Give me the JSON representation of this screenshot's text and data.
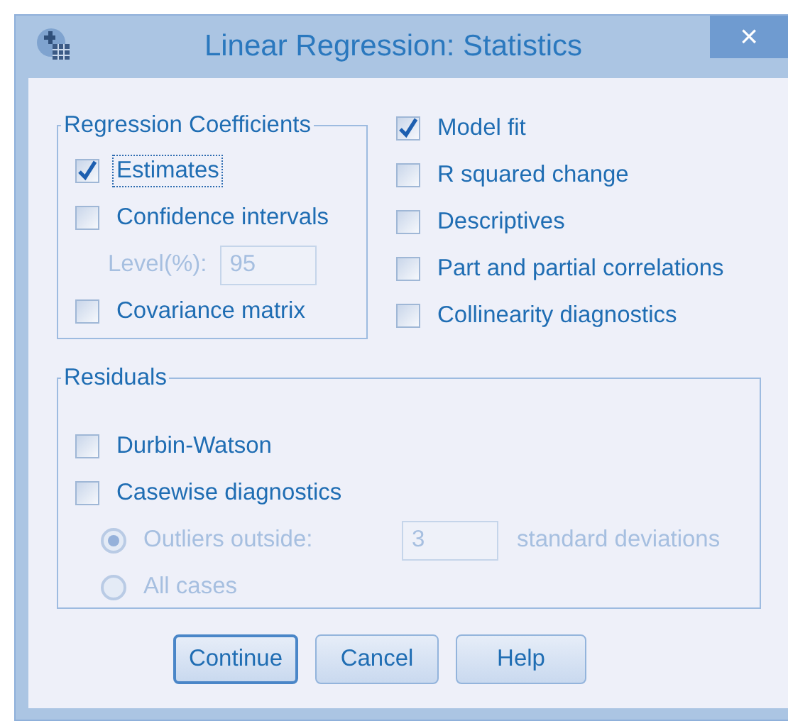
{
  "window": {
    "title": "Linear Regression: Statistics",
    "close": "×"
  },
  "regression_coefficients": {
    "title": "Regression Coefficients",
    "items": [
      {
        "kind": "checkbox",
        "label": "Estimates",
        "checked": true,
        "focused": true
      },
      {
        "kind": "checkbox",
        "label": "Confidence intervals",
        "checked": false,
        "focused": false
      },
      {
        "kind": "field",
        "label": "Level(%):",
        "value": "95",
        "disabled": true
      },
      {
        "kind": "checkbox",
        "label": "Covariance matrix",
        "checked": false,
        "focused": false
      }
    ]
  },
  "statistics": [
    {
      "label": "Model fit",
      "checked": true
    },
    {
      "label": "R squared change",
      "checked": false
    },
    {
      "label": "Descriptives",
      "checked": false
    },
    {
      "label": "Part and partial correlations",
      "checked": false
    },
    {
      "label": "Collinearity diagnostics",
      "checked": false
    }
  ],
  "residuals": {
    "title": "Residuals",
    "items": [
      {
        "kind": "checkbox",
        "label": "Durbin-Watson",
        "checked": false,
        "disabled": false
      },
      {
        "kind": "checkbox",
        "label": "Casewise diagnostics",
        "checked": false,
        "disabled": false
      },
      {
        "kind": "radio",
        "label": "Outliers outside:",
        "selected": true,
        "disabled": true,
        "value": "3",
        "suffix": "standard deviations"
      },
      {
        "kind": "radio",
        "label": "All cases",
        "selected": false,
        "disabled": true
      }
    ]
  },
  "buttons": [
    {
      "label": "Continue",
      "default": true
    },
    {
      "label": "Cancel",
      "default": false
    },
    {
      "label": "Help",
      "default": false
    }
  ]
}
